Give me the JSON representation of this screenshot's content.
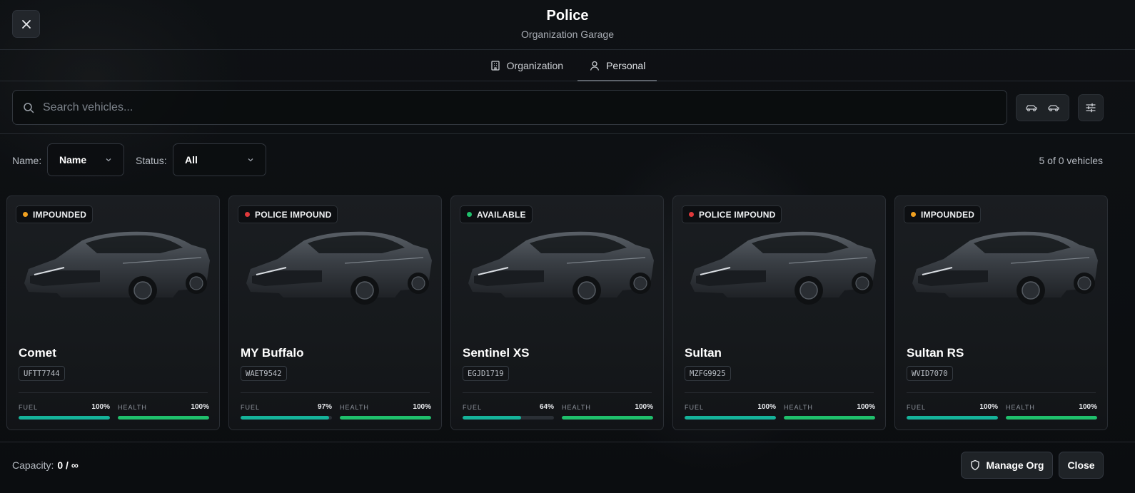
{
  "header": {
    "title": "Police",
    "subtitle": "Organization Garage"
  },
  "tabs": [
    {
      "label": "Organization",
      "icon": "building-icon",
      "active": false
    },
    {
      "label": "Personal",
      "icon": "user-icon",
      "active": true
    }
  ],
  "search": {
    "placeholder": "Search vehicles...",
    "value": ""
  },
  "filters": {
    "name_label": "Name:",
    "name_value": "Name",
    "status_label": "Status:",
    "status_value": "All"
  },
  "count_text": "5 of 0 vehicles",
  "vehicles": [
    {
      "status": "IMPOUNDED",
      "status_color": "#f0a020",
      "name": "Comet",
      "plate": "UFTT7744",
      "fuel": 100,
      "fuel_text": "100%",
      "health": 100,
      "health_text": "100%"
    },
    {
      "status": "POLICE IMPOUND",
      "status_color": "#e0393b",
      "name": "MY Buffalo",
      "plate": "WAET9542",
      "fuel": 97,
      "fuel_text": "97%",
      "health": 100,
      "health_text": "100%"
    },
    {
      "status": "AVAILABLE",
      "status_color": "#1fc06c",
      "name": "Sentinel XS",
      "plate": "EGJD1719",
      "fuel": 64,
      "fuel_text": "64%",
      "health": 100,
      "health_text": "100%"
    },
    {
      "status": "POLICE IMPOUND",
      "status_color": "#e0393b",
      "name": "Sultan",
      "plate": "MZFG9925",
      "fuel": 100,
      "fuel_text": "100%",
      "health": 100,
      "health_text": "100%"
    },
    {
      "status": "IMPOUNDED",
      "status_color": "#f0a020",
      "name": "Sultan RS",
      "plate": "WVID7070",
      "fuel": 100,
      "fuel_text": "100%",
      "health": 100,
      "health_text": "100%"
    }
  ],
  "stat_labels": {
    "fuel": "FUEL",
    "health": "HEALTH"
  },
  "footer": {
    "capacity_label": "Capacity:",
    "capacity_value": "0 / ∞",
    "manage_label": "Manage Org",
    "close_label": "Close"
  },
  "colors": {
    "fuel_bar": "#15b39a",
    "health_bar": "#1fc06c"
  }
}
